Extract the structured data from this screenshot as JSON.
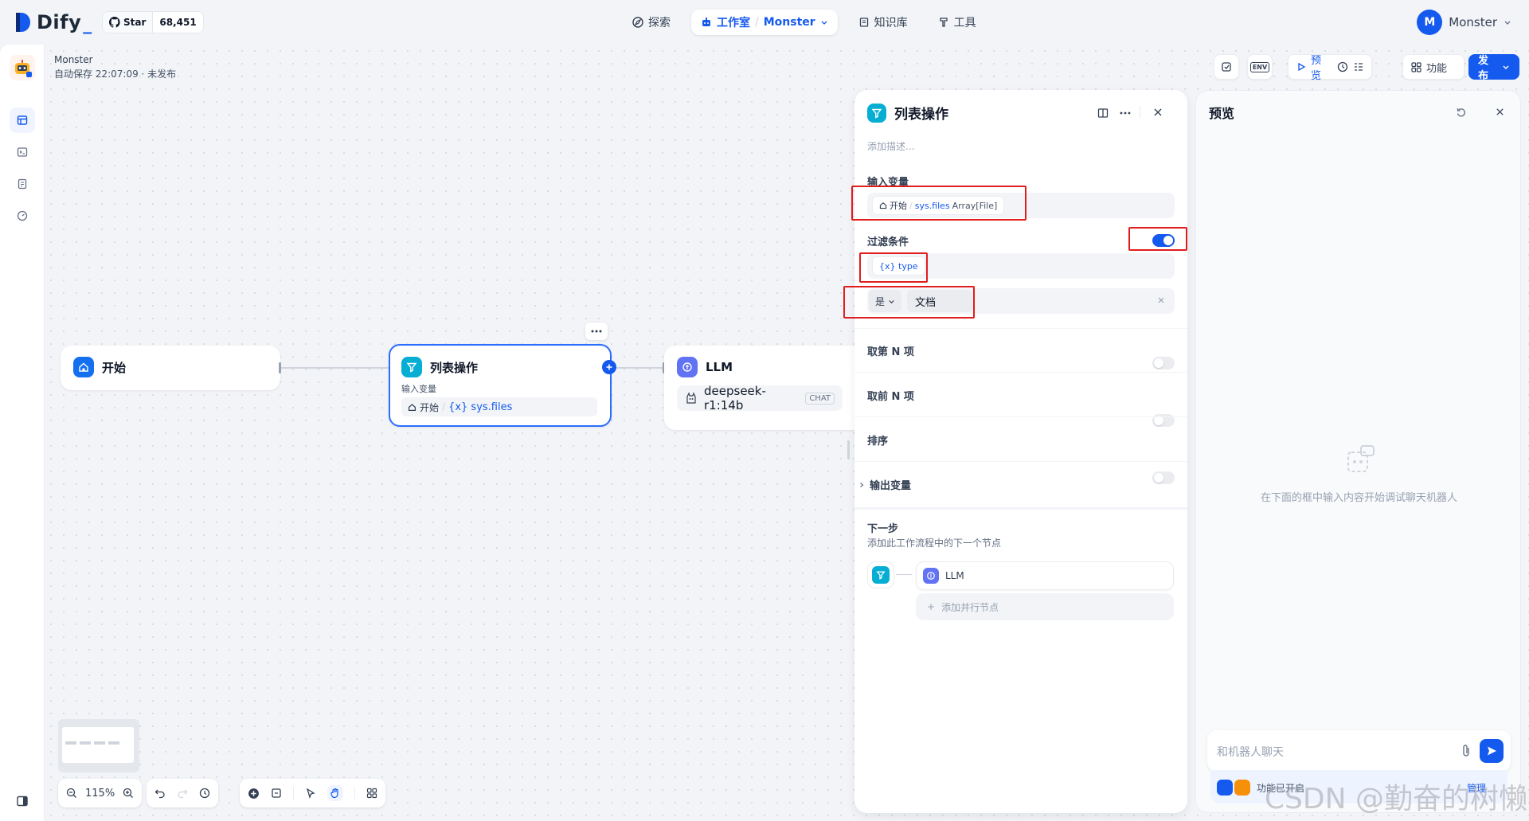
{
  "colors": {
    "accent": "#155aef",
    "start_icon": "#1570ef",
    "list_icon": "#06aed4",
    "llm_icon": "#6172f3",
    "highlight_box": "#e11d1d"
  },
  "topbar": {
    "logo": "Dify",
    "github": {
      "label": "Star",
      "count": "68,451"
    },
    "tabs": [
      {
        "label": "探索",
        "icon": "compass-icon"
      },
      {
        "label": "工作室",
        "sub": "Monster",
        "icon": "robot-icon"
      },
      {
        "label": "知识库",
        "icon": "book-icon"
      },
      {
        "label": "工具",
        "icon": "hammer-icon"
      }
    ],
    "user": {
      "initial": "M",
      "name": "Monster"
    }
  },
  "app": {
    "name": "Monster",
    "autosave": "自动保存 22:07:09 · 未发布"
  },
  "toolbar": {
    "env": "ENV",
    "preview": "预览",
    "features": "功能",
    "publish": "发布"
  },
  "nodes": {
    "start": {
      "title": "开始"
    },
    "list": {
      "title": "列表操作",
      "input_label": "输入变量",
      "src": "开始",
      "var": "{x} sys.files"
    },
    "llm": {
      "title": "LLM",
      "model": "deepseek-r1:14b",
      "mode": "CHAT"
    }
  },
  "panel": {
    "title": "列表操作",
    "desc_placeholder": "添加描述...",
    "input_var_label": "输入变量",
    "input_src": "开始",
    "input_var": "sys.files",
    "input_type": "Array[File]",
    "filter_label": "过滤条件",
    "filter_var": "{x} type",
    "operator": "是",
    "value": "文档",
    "take_nth": "取第 N 项",
    "take_first": "取前 N 项",
    "sort": "排序",
    "output_vars": "输出变量",
    "next_step": "下一步",
    "next_step_desc": "添加此工作流程中的下一个节点",
    "next_node": "LLM",
    "add_parallel": "添加并行节点"
  },
  "preview": {
    "title": "预览",
    "empty_text": "在下面的框中输入内容开始调试聊天机器人",
    "input_placeholder": "和机器人聊天",
    "feature_text": "功能已开启",
    "manage": "管理"
  },
  "controls": {
    "zoom": "115%"
  },
  "watermark": "CSDN @勤奋的树懒"
}
